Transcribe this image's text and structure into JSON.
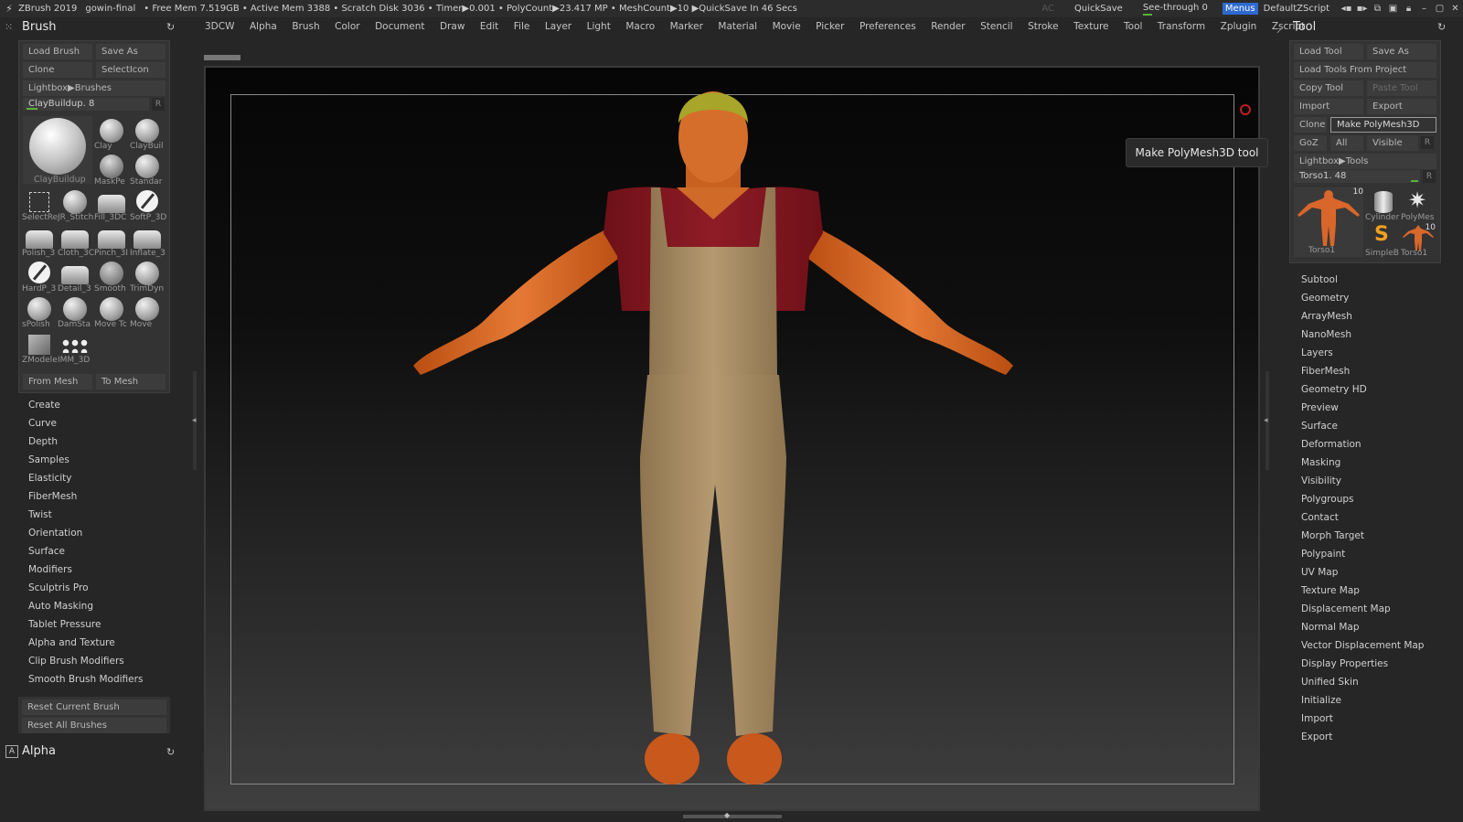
{
  "titlebar": {
    "app": "ZBrush 2019",
    "file": "gowin-final",
    "stats": "• Free Mem 7.519GB • Active Mem 3388 • Scratch Disk 3036 • Timer▶0.001 • PolyCount▶23.417 MP • MeshCount▶10 ▶QuickSave In 46 Secs",
    "ac": "AC",
    "quicksave": "QuickSave",
    "see_through": "See-through 0",
    "menus": "Menus",
    "script": "DefaultZScript"
  },
  "menubar": {
    "left_title": "Brush",
    "right_title": "Tool",
    "items": [
      "3DCW",
      "Alpha",
      "Brush",
      "Color",
      "Document",
      "Draw",
      "Edit",
      "File",
      "Layer",
      "Light",
      "Macro",
      "Marker",
      "Material",
      "Movie",
      "Picker",
      "Preferences",
      "Render",
      "Stencil",
      "Stroke",
      "Texture",
      "Tool",
      "Transform",
      "Zplugin",
      "Zscript"
    ]
  },
  "brush_panel": {
    "load": "Load Brush",
    "save": "Save As",
    "clone": "Clone",
    "select_icon": "SelectIcon",
    "lightbox": "Lightbox▶Brushes",
    "slider_label": "ClayBuildup. 8",
    "slider_r": "R",
    "main_brush": "ClayBuildup",
    "brushes": [
      "Clay",
      "ClayBuil",
      "MaskPe",
      "Standar",
      "SelectRe",
      "JR_Stitch",
      "Fill_3DC",
      "SoftP_3D",
      "Polish_3",
      "Cloth_3C",
      "Pinch_3I",
      "Inflate_3",
      "HardP_3",
      "Detail_3",
      "Smooth",
      "TrimDyn",
      "sPolish",
      "DamSta",
      "Move Tc",
      "Move",
      "ZModele",
      "IMM_3D"
    ],
    "from_mesh": "From Mesh",
    "to_mesh": "To Mesh",
    "menu": [
      "Create",
      "Curve",
      "Depth",
      "Samples",
      "Elasticity",
      "FiberMesh",
      "Twist",
      "Orientation",
      "Surface",
      "Modifiers",
      "Sculptris Pro",
      "Auto Masking",
      "Tablet Pressure",
      "Alpha and Texture",
      "Clip Brush Modifiers",
      "Smooth Brush Modifiers"
    ],
    "reset_current": "Reset Current Brush",
    "reset_all": "Reset All Brushes"
  },
  "alpha_title": "Alpha",
  "viewport": {
    "tooltip": "Make PolyMesh3D tool"
  },
  "tool_panel": {
    "load": "Load Tool",
    "save": "Save As",
    "load_project": "Load Tools From Project",
    "copy": "Copy Tool",
    "paste": "Paste Tool",
    "import": "Import",
    "export": "Export",
    "clone": "Clone",
    "make_polymesh": "Make PolyMesh3D",
    "goz": "GoZ",
    "all": "All",
    "visible": "Visible",
    "r": "R",
    "lightbox": "Lightbox▶Tools",
    "slider_label": "Torso1. 48",
    "thumbs": [
      "Torso1",
      "Cylinder",
      "PolyMes",
      "SimpleB",
      "Torso1"
    ],
    "thumb_counts": [
      "10",
      "10"
    ],
    "menu": [
      "Subtool",
      "Geometry",
      "ArrayMesh",
      "NanoMesh",
      "Layers",
      "FiberMesh",
      "Geometry HD",
      "Preview",
      "Surface",
      "Deformation",
      "Masking",
      "Visibility",
      "Polygroups",
      "Contact",
      "Morph Target",
      "Polypaint",
      "UV Map",
      "Texture Map",
      "Displacement Map",
      "Normal Map",
      "Vector Displacement Map",
      "Display Properties",
      "Unified Skin",
      "Initialize",
      "Import",
      "Export"
    ]
  }
}
